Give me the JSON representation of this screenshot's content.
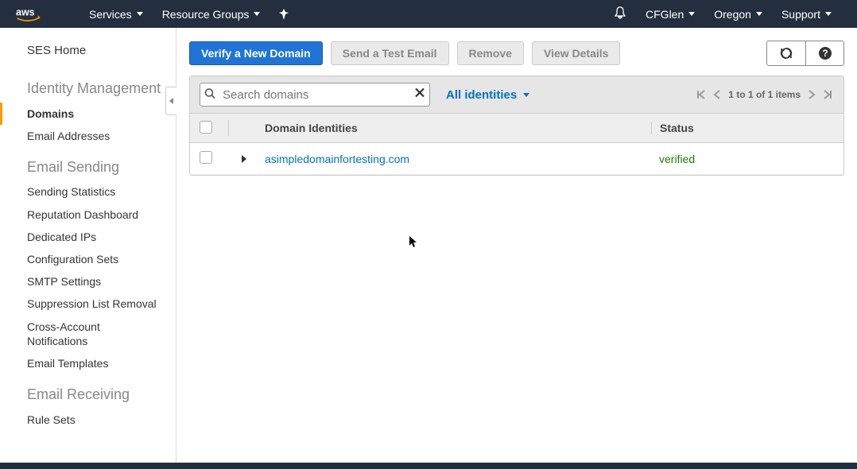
{
  "header": {
    "services": "Services",
    "resource_groups": "Resource Groups",
    "user": "CFGlen",
    "region": "Oregon",
    "support": "Support"
  },
  "sidebar": {
    "home": "SES Home",
    "sections": [
      {
        "title": "Identity Management",
        "items": [
          "Domains",
          "Email Addresses"
        ],
        "active_index": 0
      },
      {
        "title": "Email Sending",
        "items": [
          "Sending Statistics",
          "Reputation Dashboard",
          "Dedicated IPs",
          "Configuration Sets",
          "SMTP Settings",
          "Suppression List Removal",
          "Cross-Account Notifications",
          "Email Templates"
        ]
      },
      {
        "title": "Email Receiving",
        "items": [
          "Rule Sets"
        ]
      }
    ]
  },
  "toolbar": {
    "verify": "Verify a New Domain",
    "send_test": "Send a Test Email",
    "remove": "Remove",
    "view_details": "View Details"
  },
  "panel": {
    "search_placeholder": "Search domains",
    "filter_label": "All identities",
    "pager_text": "1 to 1 of 1 items",
    "columns": {
      "domain": "Domain Identities",
      "status": "Status"
    },
    "rows": [
      {
        "domain": "asimpledomainfortesting.com",
        "status": "verified"
      }
    ]
  }
}
